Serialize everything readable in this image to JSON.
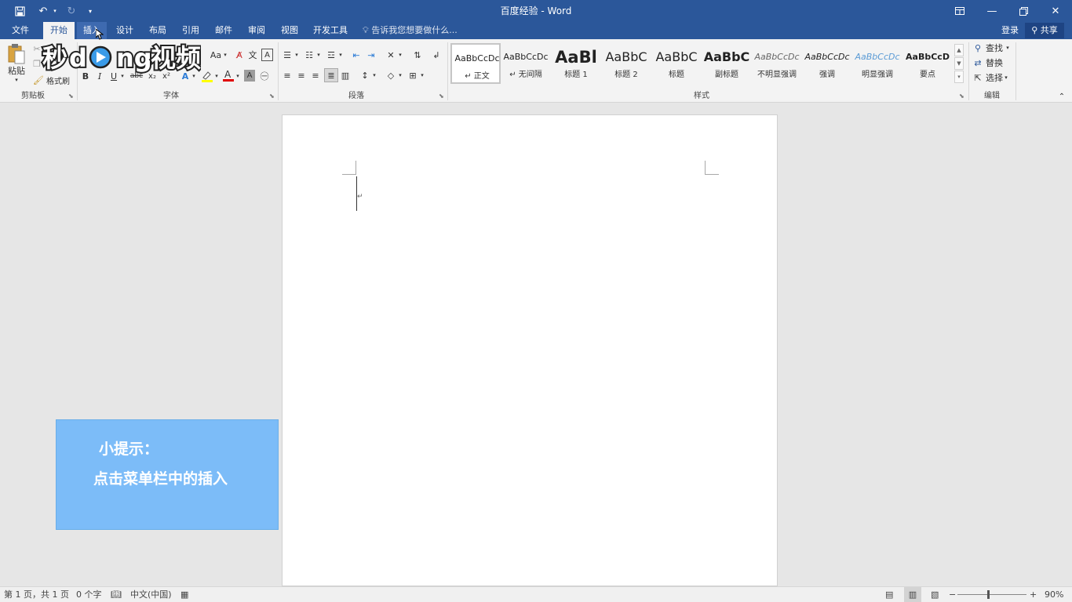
{
  "window": {
    "title": "百度经验 - Word"
  },
  "menu": {
    "tabs": [
      {
        "label": "文件"
      },
      {
        "label": "开始",
        "active": true
      },
      {
        "label": "插入"
      },
      {
        "label": "设计"
      },
      {
        "label": "布局"
      },
      {
        "label": "引用"
      },
      {
        "label": "邮件"
      },
      {
        "label": "审阅"
      },
      {
        "label": "视图"
      },
      {
        "label": "开发工具"
      }
    ],
    "tell_me": "告诉我您想要做什么...",
    "login": "登录",
    "share": "共享"
  },
  "ribbon": {
    "clipboard": {
      "label": "剪贴板",
      "paste": "粘贴",
      "format_painter": "格式刷"
    },
    "font": {
      "label": "字体",
      "change_case": "Aa",
      "bold": "B",
      "italic": "I",
      "underline": "U",
      "strike": "abc",
      "subscript": "x₂",
      "superscript": "x²"
    },
    "paragraph": {
      "label": "段落"
    },
    "styles": {
      "label": "样式",
      "items": [
        {
          "preview": "AaBbCcDc",
          "name": "↵ 正文"
        },
        {
          "preview": "AaBbCcDc",
          "name": "↵ 无间隔"
        },
        {
          "preview": "AaBl",
          "name": "标题 1"
        },
        {
          "preview": "AaBbC",
          "name": "标题 2"
        },
        {
          "preview": "AaBbC",
          "name": "标题"
        },
        {
          "preview": "AaBbC",
          "name": "副标题"
        },
        {
          "preview": "AaBbCcDc",
          "name": "不明显强调"
        },
        {
          "preview": "AaBbCcDc",
          "name": "强调"
        },
        {
          "preview": "AaBbCcDc",
          "name": "明显强调"
        },
        {
          "preview": "AaBbCcD",
          "name": "要点"
        }
      ]
    },
    "editing": {
      "label": "编辑",
      "find": "查找",
      "replace": "替换",
      "select": "选择"
    }
  },
  "hint": {
    "title": "小提示：",
    "body": "点击菜单栏中的插入"
  },
  "watermark": {
    "text": "秒懂视频"
  },
  "statusbar": {
    "page": "第 1 页，共 1 页",
    "words": "0 个字",
    "language": "中文(中国)",
    "zoom": "90%",
    "zoom_level": 90
  },
  "colors": {
    "title_bar": "#2b579a",
    "ribbon_bg": "#f3f3f3",
    "hint_bg": "#7cbcf8",
    "font_color_red": "#e00000",
    "highlight_yellow": "#ffff00"
  }
}
